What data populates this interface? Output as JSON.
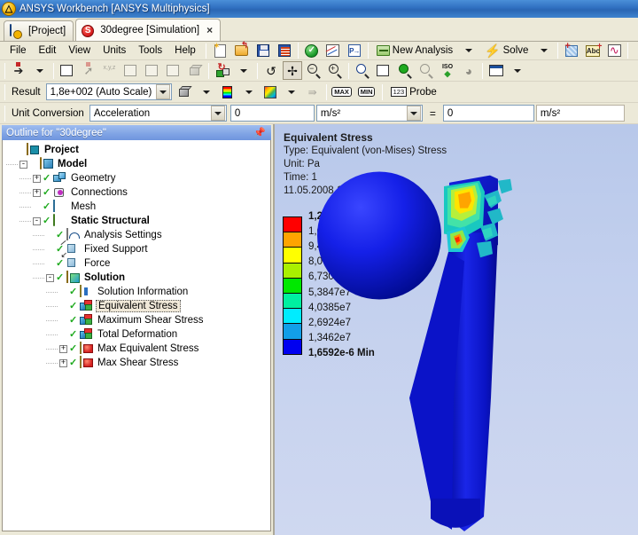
{
  "window": {
    "title": "ANSYS Workbench [ANSYS Multiphysics]",
    "logo_icon": "ansys-logo-icon"
  },
  "tabs": [
    {
      "label": "[Project]",
      "icon": "project-icon",
      "active": false
    },
    {
      "label": "30degree [Simulation]",
      "icon": "simulation-icon",
      "active": true,
      "close": "×"
    }
  ],
  "menu": [
    {
      "label": "File"
    },
    {
      "label": "Edit"
    },
    {
      "label": "View"
    },
    {
      "label": "Units"
    },
    {
      "label": "Tools"
    },
    {
      "label": "Help"
    }
  ],
  "standard_toolbar": [
    {
      "icon": "new-document-icon",
      "label": ""
    },
    {
      "icon": "open-folder-icon",
      "label": ""
    },
    {
      "icon": "save-icon",
      "label": ""
    },
    {
      "icon": "save-all-icon",
      "label": ""
    },
    {
      "icon": "green-check-icon",
      "label": ""
    },
    {
      "icon": "chart-icon",
      "label": ""
    },
    {
      "icon": "parameters-icon",
      "label": ""
    },
    {
      "icon": "new-analysis-icon",
      "label": "New Analysis"
    },
    {
      "icon": "solve-lightning-icon",
      "label": "Solve"
    },
    {
      "icon": "worksheet-icon",
      "label": ""
    },
    {
      "icon": "annotation-abc-icon",
      "label": ""
    },
    {
      "icon": "graph-wave-icon",
      "label": ""
    }
  ],
  "graphics_toolbar": [
    {
      "icon": "select-pointer-icon"
    },
    {
      "icon": "select-mode-icon"
    },
    {
      "icon": "extend-selection-icon"
    },
    {
      "icon": "xyz-coordinate-icon"
    },
    {
      "icon": "vertex-select-icon"
    },
    {
      "icon": "edge-select-icon"
    },
    {
      "icon": "face-select-icon"
    },
    {
      "icon": "body-select-icon"
    },
    {
      "icon": "rotate-cube-icon"
    },
    {
      "icon": "refresh-icon"
    },
    {
      "icon": "pan-icon"
    },
    {
      "icon": "zoom-out-icon"
    },
    {
      "icon": "zoom-in-icon"
    },
    {
      "icon": "box-zoom-icon"
    },
    {
      "icon": "zoom-to-fit-icon"
    },
    {
      "icon": "magnify-green-icon"
    },
    {
      "icon": "magnify-gray-icon"
    },
    {
      "icon": "iso-view-icon"
    },
    {
      "icon": "look-at-icon"
    },
    {
      "icon": "window-layout-icon"
    }
  ],
  "result_bar": {
    "label": "Result",
    "scale_value": "1,8e+002 (Auto Scale)",
    "buttons": [
      {
        "icon": "geometry-cube-icon"
      },
      {
        "icon": "legend-bands-icon"
      },
      {
        "icon": "contour-rainbow-icon"
      },
      {
        "icon": "vector-arrows-icon"
      },
      {
        "icon": "max-tag-icon",
        "label": "MAX"
      },
      {
        "icon": "min-tag-icon",
        "label": "MIN"
      },
      {
        "icon": "probe-123-icon",
        "label": "Probe"
      }
    ],
    "probe_label": "Probe"
  },
  "unit_conversion": {
    "label": "Unit Conversion",
    "quantity": "Acceleration",
    "input_value": "0",
    "from_unit": "m/s²",
    "equals": "=",
    "output_value": "0",
    "to_unit": "m/s²"
  },
  "outline": {
    "header": "Outline for \"30degree\"",
    "pin_icon": "pin-icon",
    "tree": [
      {
        "label": "Project",
        "depth": 0,
        "expander": "",
        "check": false,
        "bold": true,
        "icon": "project-folder-icon",
        "selected": false
      },
      {
        "label": "Model",
        "depth": 1,
        "expander": "-",
        "check": false,
        "bold": true,
        "icon": "model-icon",
        "selected": false
      },
      {
        "label": "Geometry",
        "depth": 2,
        "expander": "+",
        "check": true,
        "bold": false,
        "icon": "geometry-icon",
        "selected": false
      },
      {
        "label": "Connections",
        "depth": 2,
        "expander": "+",
        "check": true,
        "bold": false,
        "icon": "connections-icon",
        "selected": false
      },
      {
        "label": "Mesh",
        "depth": 2,
        "expander": "",
        "check": true,
        "bold": false,
        "icon": "mesh-icon",
        "selected": false
      },
      {
        "label": "Static Structural",
        "depth": 2,
        "expander": "-",
        "check": true,
        "bold": true,
        "icon": "static-structural-icon",
        "selected": false
      },
      {
        "label": "Analysis Settings",
        "depth": 3,
        "expander": "",
        "check": true,
        "bold": false,
        "icon": "analysis-settings-icon",
        "selected": false
      },
      {
        "label": "Fixed Support",
        "depth": 3,
        "expander": "",
        "check": true,
        "bold": false,
        "icon": "fixed-support-icon",
        "selected": false
      },
      {
        "label": "Force",
        "depth": 3,
        "expander": "",
        "check": true,
        "bold": false,
        "icon": "force-icon",
        "selected": false
      },
      {
        "label": "Solution",
        "depth": 3,
        "expander": "-",
        "check": true,
        "bold": true,
        "icon": "solution-icon",
        "selected": false
      },
      {
        "label": "Solution Information",
        "depth": 4,
        "expander": "",
        "check": true,
        "bold": false,
        "icon": "solution-information-icon",
        "selected": false
      },
      {
        "label": "Equivalent Stress",
        "depth": 4,
        "expander": "",
        "check": true,
        "bold": false,
        "icon": "result-icon",
        "selected": true
      },
      {
        "label": "Maximum Shear Stress",
        "depth": 4,
        "expander": "",
        "check": true,
        "bold": false,
        "icon": "result-icon",
        "selected": false
      },
      {
        "label": "Total Deformation",
        "depth": 4,
        "expander": "",
        "check": true,
        "bold": false,
        "icon": "result-icon",
        "selected": false
      },
      {
        "label": "Max Equivalent Stress",
        "depth": 4,
        "expander": "+",
        "check": true,
        "bold": false,
        "icon": "max-result-icon",
        "selected": false
      },
      {
        "label": "Max Shear Stress",
        "depth": 4,
        "expander": "+",
        "check": true,
        "bold": false,
        "icon": "max-result-icon",
        "selected": false
      }
    ]
  },
  "viewport": {
    "title": "Equivalent Stress",
    "type_line": "Type: Equivalent (von-Mises) Stress",
    "unit_line": "Unit: Pa",
    "time_line": "Time: 1",
    "timestamp": "11.05.2008 19:37",
    "legend": {
      "max_label": "1,2116e8 Max",
      "min_label": "1,6592e-6 Min",
      "ticks": [
        "1,0769e8",
        "9,4233e7",
        "8,0771e7",
        "6,7309e7",
        "5,3847e7",
        "4,0385e7",
        "2,6924e7",
        "1,3462e7"
      ],
      "colors": [
        "#ff0000",
        "#ffa400",
        "#ffff00",
        "#aaf000",
        "#00e800",
        "#00f0a0",
        "#00ecff",
        "#129ee8",
        "#0000f0"
      ]
    }
  },
  "colors": {
    "titlebar_blue": "#2f6fc0",
    "panel_beige": "#ece9d8",
    "outline_header": "#7fa3e4",
    "viewport_bg_top": "#b8c8ea",
    "viewport_bg_bottom": "#cfd8f0",
    "model_blue": "#0b14cf",
    "check_green": "#1faa1f"
  }
}
